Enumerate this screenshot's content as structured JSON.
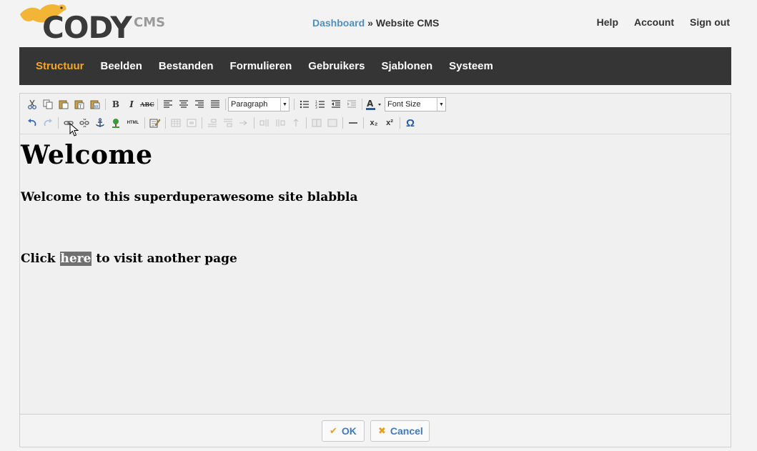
{
  "logo": {
    "brand": "CODY",
    "suffix": "CMS"
  },
  "breadcrumb": {
    "link": "Dashboard",
    "separator": "»",
    "current": "Website CMS"
  },
  "toplinks": {
    "help": "Help",
    "account": "Account",
    "signout": "Sign out"
  },
  "nav": {
    "items": [
      {
        "label": "Structuur",
        "active": true
      },
      {
        "label": "Beelden"
      },
      {
        "label": "Bestanden"
      },
      {
        "label": "Formulieren"
      },
      {
        "label": "Gebruikers"
      },
      {
        "label": "Sjablonen"
      },
      {
        "label": "Systeem"
      }
    ]
  },
  "toolbar": {
    "format_select": "Paragraph",
    "fontsize_select": "Font Size",
    "html_label": "HTML",
    "bold": "B",
    "italic": "I",
    "strike": "ABC",
    "omega": "Ω",
    "sub": "x₂",
    "sup": "x²"
  },
  "content": {
    "heading": "Welcome",
    "line1": "Welcome to this superduperawesome site blabbla",
    "line2_before": "Click ",
    "line2_selected": "here",
    "line2_after": " to visit another page"
  },
  "actions": {
    "ok": "OK",
    "cancel": "Cancel"
  },
  "colors": {
    "accent": "#f5a623",
    "link": "#4f8fbf",
    "nav_bg": "#353535"
  }
}
